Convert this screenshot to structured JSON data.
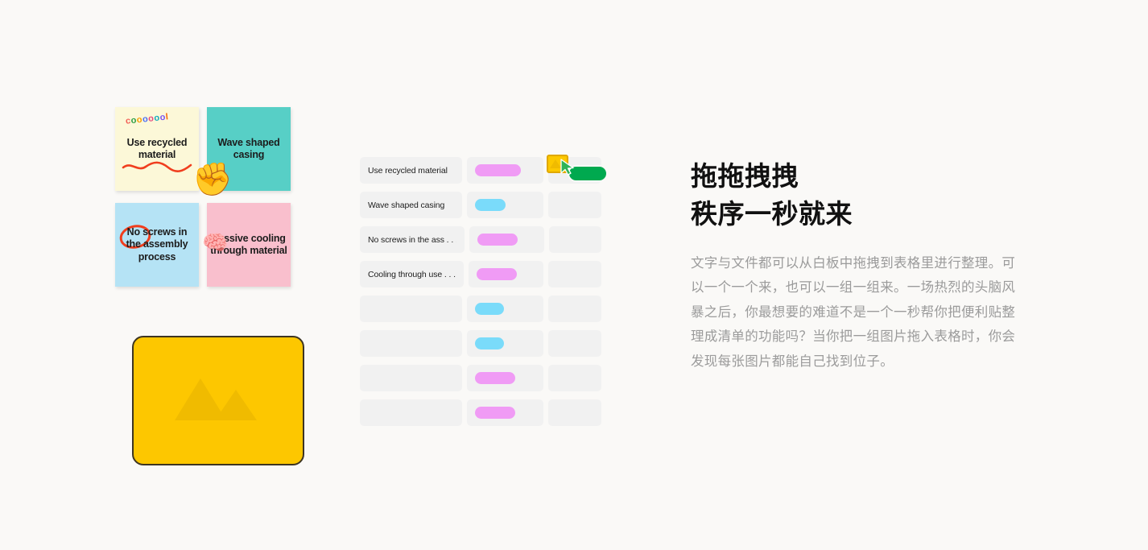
{
  "sticky_notes": [
    {
      "text": "Use recycled material",
      "color": "#fcf8d8",
      "decoration": "cool-sticker-squiggle"
    },
    {
      "text": "Wave shaped casing",
      "color": "#57cfc6",
      "decoration": "hand-emoji"
    },
    {
      "text": "No screws in the assembly process",
      "color": "#b5e3f5",
      "decoration": "orange-circle"
    },
    {
      "text": "Passive cooling through material",
      "color": "#f9bfcd",
      "decoration": "brain-emoji"
    }
  ],
  "decorations": {
    "cool_sticker": "cooooool",
    "hand_emoji": "✊",
    "brain_emoji": "🧠"
  },
  "image_card": {
    "icon": "mountain-image-placeholder-icon",
    "color": "#fdc700"
  },
  "table": {
    "rows": [
      {
        "title": "Use recycled material",
        "tag_color": "pink",
        "tag_width": 57,
        "extra": ""
      },
      {
        "title": "Wave shaped casing",
        "tag_color": "blue",
        "tag_width": 38,
        "extra": ""
      },
      {
        "title": "No screws in the ass . . .",
        "tag_color": "pink",
        "tag_width": 50,
        "extra": "drop-target"
      },
      {
        "title": "Cooling through use . . .",
        "tag_color": "pink",
        "tag_width": 50,
        "extra": ""
      },
      {
        "title": "",
        "tag_color": "blue",
        "tag_width": 36,
        "extra": ""
      },
      {
        "title": "",
        "tag_color": "blue",
        "tag_width": 36,
        "extra": ""
      },
      {
        "title": "",
        "tag_color": "pink",
        "tag_width": 50,
        "extra": ""
      },
      {
        "title": "",
        "tag_color": "pink",
        "tag_width": 50,
        "extra": ""
      }
    ]
  },
  "drag_indicator": {
    "thumbnail_icon": "image-thumbnail-icon",
    "cursor_icon": "arrow-cursor-icon",
    "badge_color": "#00a94f",
    "thumbnail_color": "#fcc800"
  },
  "text_column": {
    "headline_line_1": "拖拖拽拽",
    "headline_line_2": "秩序一秒就来",
    "body": "文字与文件都可以从白板中拖拽到表格里进行整理。可以一个一个来，也可以一组一组来。一场热烈的头脑风暴之后，你最想要的难道不是一个一秒帮你把便利贴整理成清单的功能吗？当你把一组图片拖入表格时，你会发现每张图片都能自己找到位子。"
  },
  "colors": {
    "page_background": "#faf9f7",
    "cell_background": "#f1f1f1",
    "pill_pink": "#f09bf5",
    "pill_blue": "#7adbfa",
    "accent_green": "#00a94f",
    "headline": "#111111",
    "body_text": "#9b9b9b"
  }
}
